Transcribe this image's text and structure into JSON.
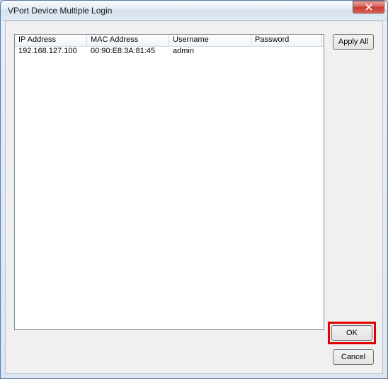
{
  "window": {
    "title": "VPort Device Multiple Login"
  },
  "table": {
    "headers": {
      "ip": "IP Address",
      "mac": "MAC Address",
      "user": "Username",
      "pass": "Password"
    },
    "rows": [
      {
        "ip": "192.168.127.100",
        "mac": "00:90:E8:3A:81:45",
        "user": "admin",
        "pass": ""
      }
    ]
  },
  "buttons": {
    "apply_all": "Apply All",
    "ok": "OK",
    "cancel": "Cancel"
  }
}
